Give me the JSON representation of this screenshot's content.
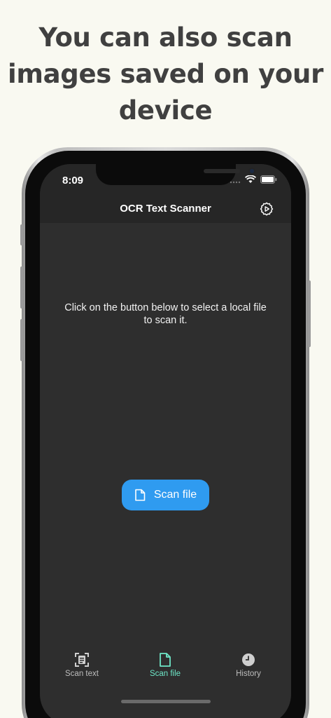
{
  "headline": {
    "line1": "You can also scan",
    "line2": "images saved on your",
    "line3": "device"
  },
  "status_bar": {
    "time": "8:09"
  },
  "app_bar": {
    "title": "OCR Text Scanner",
    "settings_icon": "gear-icon"
  },
  "main": {
    "instruction_line1": "Click on the button below to select a local file",
    "instruction_line2": "to scan it.",
    "scan_button": {
      "label": "Scan file",
      "icon": "file-icon",
      "color": "#2f9bf0"
    }
  },
  "tabs": [
    {
      "label": "Scan text",
      "icon": "scan-text-icon",
      "active": false
    },
    {
      "label": "Scan file",
      "icon": "file-icon",
      "active": true
    },
    {
      "label": "History",
      "icon": "clock-icon",
      "active": false
    }
  ],
  "colors": {
    "background": "#f9f9f1",
    "screen": "#2e2e2e",
    "app_bar": "#262626",
    "accent": "#6ee7c8",
    "button": "#2f9bf0"
  }
}
